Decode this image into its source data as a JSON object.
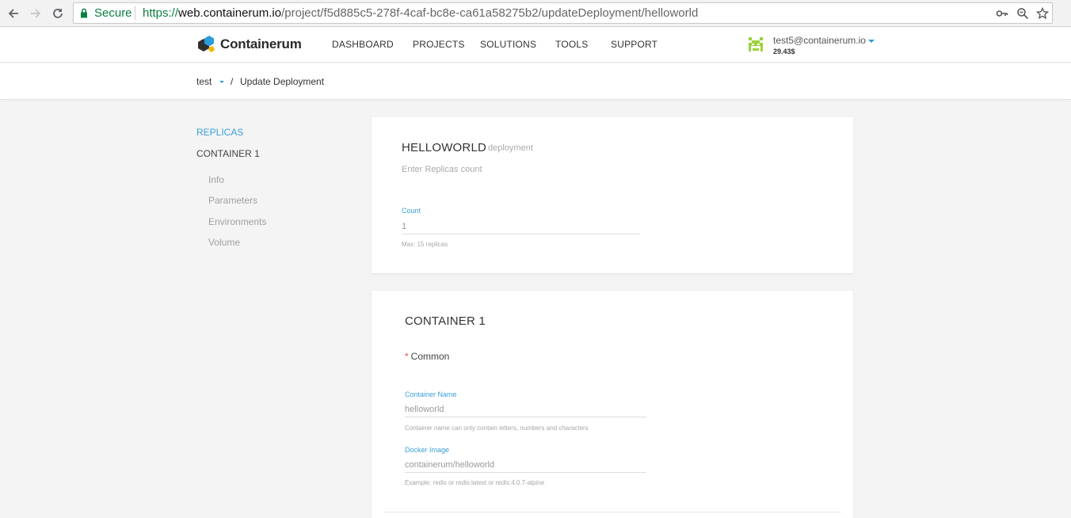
{
  "browser": {
    "secure_label": "Secure",
    "url_scheme": "https://",
    "url_host": "web.containerum.io",
    "url_path": "/project/f5d885c5-278f-4caf-bc8e-ca61a58275b2/updateDeployment/helloworld",
    "icons": [
      "back-icon",
      "forward-icon",
      "reload-icon",
      "lock-icon",
      "key-icon",
      "zoom-icon",
      "star-icon"
    ]
  },
  "header": {
    "logo_text": "Containerum",
    "nav": [
      "DASHBOARD",
      "PROJECTS",
      "SOLUTIONS",
      "TOOLS",
      "SUPPORT"
    ],
    "user_email": "test5@containerum.io",
    "user_balance": "29.43$",
    "accent_color": "#2d9cdb"
  },
  "breadcrumb": {
    "project": "test",
    "separator": "/",
    "page": "Update Deployment"
  },
  "sidebar": {
    "replicas": "REPLICAS",
    "container": "CONTAINER 1",
    "items": [
      "Info",
      "Parameters",
      "Environments",
      "Volume"
    ]
  },
  "replicas_card": {
    "title": "HELLOWORLD",
    "subtitle": "deployment",
    "description": "Enter Replicas count",
    "count_label": "Count",
    "count_value": "1",
    "count_hint": "Max: 15 replicas"
  },
  "container_card": {
    "title": "CONTAINER 1",
    "section_required": "*",
    "section_label": "Common",
    "name_label": "Container Name",
    "name_value": "helloworld",
    "name_hint": "Container name can only contain letters, numbers and characters",
    "image_label": "Docker Image",
    "image_value": "containerum/helloworld",
    "image_hint": "Example: redis or redis:latest or redis:4.0.7-alpine"
  }
}
